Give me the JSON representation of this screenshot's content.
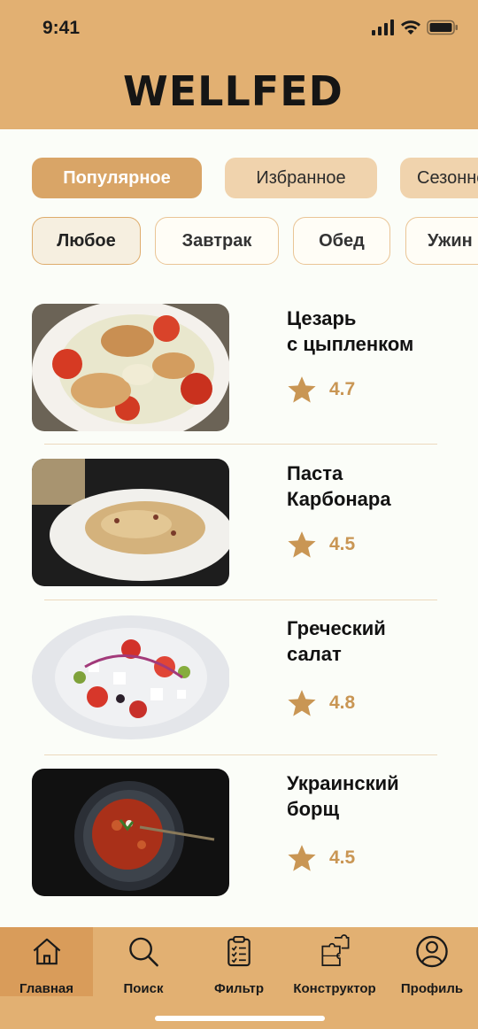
{
  "status": {
    "time": "9:41"
  },
  "app": {
    "brand": "WELLFED"
  },
  "sort_chips": [
    {
      "label": "Популярное",
      "active": true
    },
    {
      "label": "Избранное",
      "active": false
    },
    {
      "label": "Сезонное",
      "active": false
    }
  ],
  "meal_chips": [
    {
      "label": "Любое",
      "active": true
    },
    {
      "label": "Завтрак",
      "active": false
    },
    {
      "label": "Обед",
      "active": false
    },
    {
      "label": "Ужин",
      "active": false
    }
  ],
  "dishes": [
    {
      "name_line1": "Цезарь",
      "name_line2": "с цыпленком",
      "rating": "4.7",
      "image": "caesar-salad-photo"
    },
    {
      "name_line1": "Паста",
      "name_line2": "Карбонара",
      "rating": "4.5",
      "image": "pasta-carbonara-photo"
    },
    {
      "name_line1": "Греческий",
      "name_line2": "салат",
      "rating": "4.8",
      "image": "greek-salad-photo"
    },
    {
      "name_line1": "Украинский",
      "name_line2": "борщ",
      "rating": "4.5",
      "image": "borscht-photo"
    }
  ],
  "tabbar": [
    {
      "label": "Главная",
      "icon": "home-icon",
      "active": true
    },
    {
      "label": "Поиск",
      "icon": "search-icon",
      "active": false
    },
    {
      "label": "Фильтр",
      "icon": "clipboard-icon",
      "active": false
    },
    {
      "label": "Конструктор",
      "icon": "puzzle-icon",
      "active": false
    },
    {
      "label": "Профиль",
      "icon": "profile-icon",
      "active": false
    }
  ],
  "colors": {
    "accent": "#e2b072",
    "chip_active": "#d9a567",
    "rating": "#c99654"
  }
}
